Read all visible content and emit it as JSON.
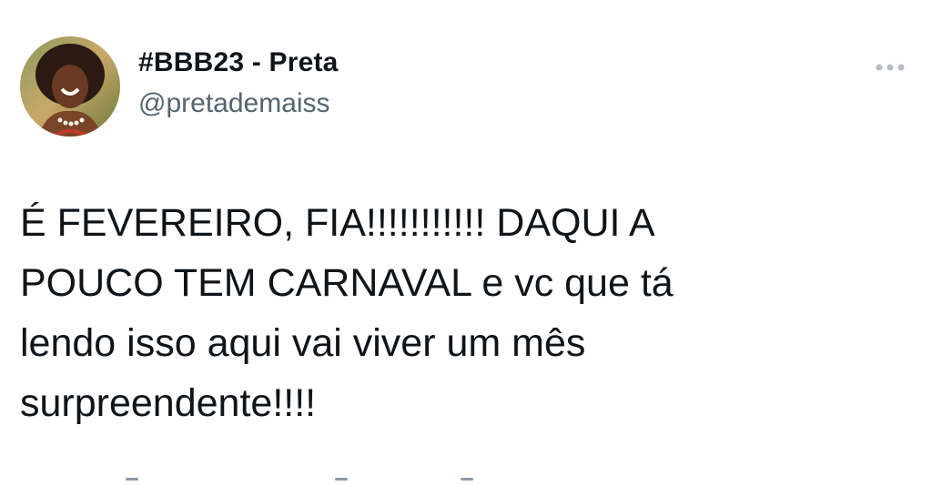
{
  "author": {
    "display_name": "#BBB23 - Preta",
    "handle": "@pretademaiss"
  },
  "tweet": {
    "text_lines": [
      "É FEVEREIRO, FIA!!!!!!!!!!! DAQUI A",
      "POUCO TEM CARNAVAL e vc que tá",
      "lendo isso aqui vai viver um mês",
      "surpreendente!!!!"
    ]
  },
  "icons": {
    "more": "more-horizontal-icon",
    "avatar": "avatar-image"
  },
  "colors": {
    "text_primary": "#0f1419",
    "text_secondary": "#536471",
    "background": "#ffffff"
  }
}
